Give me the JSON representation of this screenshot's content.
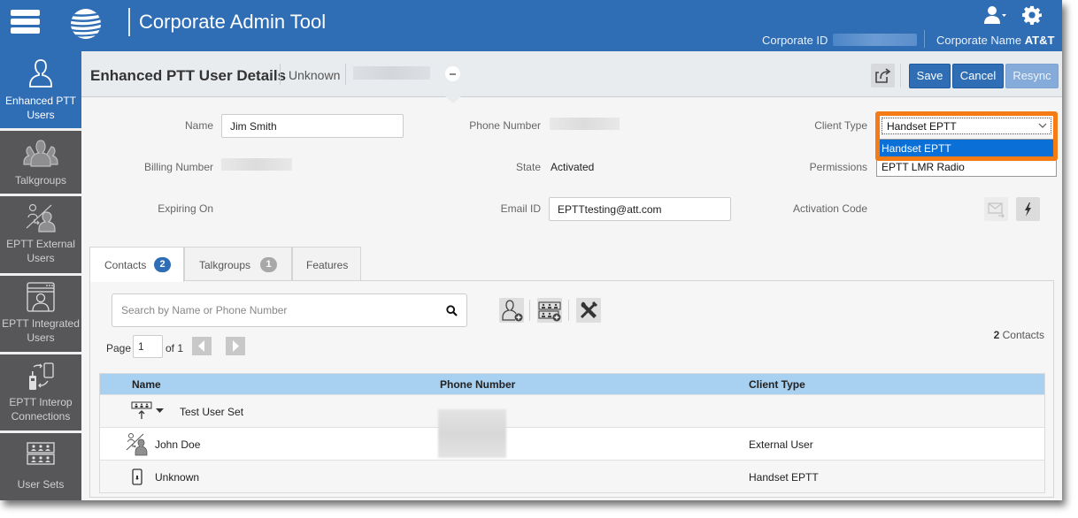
{
  "header": {
    "app_title": "Corporate Admin Tool",
    "corporate_id_label": "Corporate ID",
    "corporate_name_label": "Corporate Name",
    "corporate_name_value": "AT&T",
    "icons": [
      "menu-icon",
      "att-logo",
      "user-menu-icon",
      "gear-icon"
    ]
  },
  "sidebar": {
    "items": [
      {
        "label": "Enhanced PTT Users",
        "icon": "user-icon",
        "active": true
      },
      {
        "label": "Talkgroups",
        "icon": "talkgroup-icon",
        "active": false
      },
      {
        "label": "EPTT External Users",
        "icon": "external-user-icon",
        "active": false
      },
      {
        "label": "EPTT Integrated Users",
        "icon": "integrated-user-icon",
        "active": false
      },
      {
        "label": "EPTT Interop Connections",
        "icon": "interop-icon",
        "active": false
      },
      {
        "label": "User Sets",
        "icon": "user-sets-icon",
        "active": false
      }
    ]
  },
  "details": {
    "title": "Enhanced PTT User Details",
    "subtitle": "Unknown",
    "buttons": {
      "save": "Save",
      "cancel": "Cancel",
      "resync": "Resync"
    }
  },
  "form": {
    "name_label": "Name",
    "name_value": "Jim Smith",
    "billing_label": "Billing Number",
    "expiring_label": "Expiring On",
    "phone_label": "Phone Number",
    "state_label": "State",
    "state_value": "Activated",
    "email_label": "Email ID",
    "email_value": "EPTTtesting@att.com",
    "client_type_label": "Client Type",
    "client_type_value": "Handset EPTT",
    "client_type_options": [
      "Handset EPTT",
      "EPTT LMR Radio"
    ],
    "permissions_label": "Permissions",
    "activation_label": "Activation Code"
  },
  "tabs": [
    {
      "label": "Contacts",
      "badge": "2",
      "active": true
    },
    {
      "label": "Talkgroups",
      "badge": "1",
      "active": false
    },
    {
      "label": "Features",
      "badge": null,
      "active": false
    }
  ],
  "contacts": {
    "search_placeholder": "Search by Name or Phone Number",
    "page_label": "Page",
    "page_value": "1",
    "page_of": "of 1",
    "count_number": "2",
    "count_label": " Contacts",
    "columns": [
      "Name",
      "Phone Number",
      "Client Type"
    ],
    "rows": [
      {
        "name": "Test User Set",
        "phone": "",
        "client_type": "",
        "icon": "user-set-icon"
      },
      {
        "name": "John Doe",
        "phone": "",
        "client_type": "External User",
        "icon": "external-user-icon"
      },
      {
        "name": "Unknown",
        "phone": "",
        "client_type": "Handset EPTT",
        "icon": "handset-icon"
      }
    ]
  }
}
